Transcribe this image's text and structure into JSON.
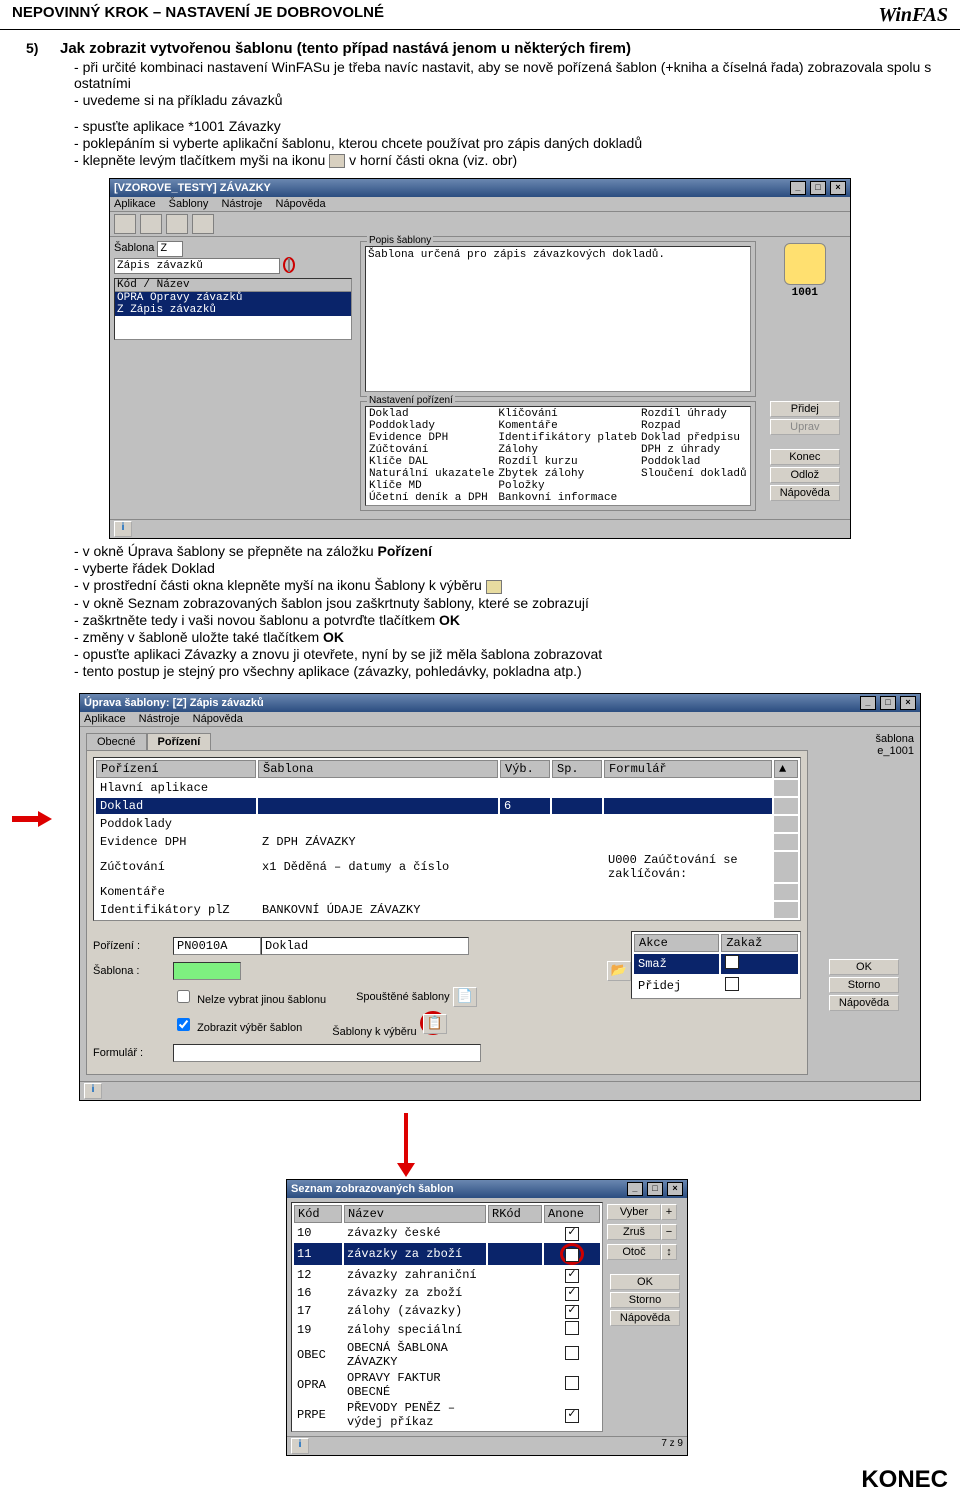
{
  "header": {
    "left": "NEPOVINNÝ KROK – NASTAVENÍ JE DOBROVOLNÉ",
    "brand": "WinFAS"
  },
  "section5": {
    "num": "5)",
    "title": "Jak zobrazit vytvořenou šablonu (tento případ nastává jenom u některých firem)",
    "b1": "při určité kombinaci nastavení WinFASu je třeba navíc nastavit, aby se nově pořízená šablon (+kniha a číselná řada) zobrazovala spolu s ostatními",
    "b2": "uvedeme si na příkladu závazků",
    "b3": "spusťte aplikace *1001 Závazky",
    "b4": "poklepáním si vyberte aplikační šablonu, kterou chcete používat pro zápis daných dokladů",
    "b5a": "klepněte levým tlačítkem myši na ikonu ",
    "b5b": " v horní části okna  (viz. obr)"
  },
  "win1": {
    "title": "[VZOROVE_TESTY] ZÁVAZKY",
    "menu": [
      "Aplikace",
      "Šablony",
      "Nástroje",
      "Nápověda"
    ],
    "sablona_label": "Šablona",
    "sablona_code": "Z",
    "sablona_name": "Zápis závazků",
    "list_header": "Kód / Název",
    "list_rows": [
      "OPRA Opravy závazků",
      "Z    Zápis závazků"
    ],
    "popis_legend": "Popis šablony",
    "popis_text": "Šablona určená pro zápis závazkových dokladů.",
    "nast_legend": "Nastavení pořízení",
    "nast_items": [
      [
        "Doklad",
        "Klíčování",
        "Rozdíl úhrady"
      ],
      [
        "Poddoklady",
        "Komentáře",
        "Rozpad"
      ],
      [
        "Evidence DPH",
        "Identifikátory plateb",
        "Doklad předpisu"
      ],
      [
        "Zúčtování",
        "Zálohy",
        "DPH z úhrady"
      ],
      [
        "Klíče DAL",
        "Rozdíl kurzu",
        "Poddoklad"
      ],
      [
        "Naturální ukazatele",
        "Zbytek zálohy",
        "Sloučení dokladů"
      ],
      [
        "Klíče MD",
        "Položky",
        ""
      ],
      [
        "Účetní deník a DPH",
        "Bankovní informace",
        ""
      ]
    ],
    "app_code": "1001",
    "btns": {
      "pridej": "Přidej",
      "uprav": "Uprav",
      "konec": "Konec",
      "odloz": "Odlož",
      "napoveda": "Nápověda"
    }
  },
  "instr2": {
    "b1a": "v okně Úprava šablony se přepněte na záložku ",
    "b1b": "Pořízení",
    "b2": "vyberte řádek Doklad",
    "b3a": "v prostřední části okna klepněte myší na ikonu Šablony k výběru ",
    "b4": "v okně Seznam zobrazovaných šablon jsou zaškrtnuty šablony, které se zobrazují",
    "b5a": "zaškrtněte tedy i vaši novou šablonu a potvrďte tlačítkem ",
    "b5b": "OK",
    "b6a": "změny v šabloně uložte také tlačítkem ",
    "b6b": "OK",
    "b7": "opusťte aplikaci Závazky a znovu ji otevřete, nyní by se již měla šablona zobrazovat",
    "b8": "tento postup je stejný pro všechny aplikace (závazky, pohledávky, pokladna atp.)"
  },
  "win2": {
    "title": "Úprava šablony: [Z] Zápis závazků",
    "menu": [
      "Aplikace",
      "Nástroje",
      "Nápověda"
    ],
    "tabs": {
      "obecne": "Obecné",
      "porizeni": "Pořízení"
    },
    "sablona_lbl": "šablona",
    "sablona_val": "e_1001",
    "cols": [
      "Pořízení",
      "Šablona",
      "Výb.",
      "Sp.",
      "Formulář"
    ],
    "rows": [
      {
        "c": [
          "Hlavní aplikace",
          "",
          "",
          "",
          ""
        ]
      },
      {
        "c": [
          "Doklad",
          "",
          "6",
          "",
          ""
        ],
        "sel": true
      },
      {
        "c": [
          "Poddoklady",
          "",
          "",
          "",
          ""
        ]
      },
      {
        "c": [
          "Evidence DPH",
          "Z   DPH ZÁVAZKY",
          "",
          "",
          ""
        ]
      },
      {
        "c": [
          "Zúčtování",
          "x1  Děděná – datumy a číslo",
          "",
          "",
          "U000 Zaúčtování se zaklíčován:"
        ]
      },
      {
        "c": [
          "Komentáře",
          "",
          "",
          "",
          ""
        ]
      },
      {
        "c": [
          "Identifikátory plZ",
          "BANKOVNÍ ÚDAJE ZÁVAZKY",
          "",
          "",
          ""
        ]
      }
    ],
    "frm": {
      "porizeni_lbl": "Pořízení :",
      "porizeni_val": "PN0010A",
      "porizeni_txt": "Doklad",
      "sablona_lbl": "Šablona :",
      "chk1": "Nelze vybrat jinou šablonu",
      "spoustene": "Spouštěné šablony",
      "chk2": "Zobrazit výběr šablon",
      "kvyberu": "Šablony k výběru",
      "form_lbl": "Formulář :"
    },
    "akce": {
      "hdr_akce": "Akce",
      "hdr_zakaz": "Zakaž",
      "smaz": "Smaž",
      "pridej": "Přidej"
    },
    "btns": {
      "ok": "OK",
      "storno": "Storno",
      "napoveda": "Nápověda"
    }
  },
  "win3": {
    "title": "Seznam zobrazovaných šablon",
    "cols": [
      "Kód",
      "Název",
      "RKód",
      "Anone"
    ],
    "rows": [
      {
        "k": "10",
        "n": "závazky české",
        "a": true
      },
      {
        "k": "11",
        "n": "závazky za zboží",
        "a": true,
        "sel": true
      },
      {
        "k": "12",
        "n": "závazky zahraniční",
        "a": true
      },
      {
        "k": "16",
        "n": "závazky za zboží",
        "a": true
      },
      {
        "k": "17",
        "n": "zálohy (závazky)",
        "a": true
      },
      {
        "k": "19",
        "n": "zálohy speciální",
        "a": false
      },
      {
        "k": "OBEC",
        "n": "OBECNÁ ŠABLONA ZÁVAZKY",
        "a": false
      },
      {
        "k": "OPRA",
        "n": "OPRAVY FAKTUR OBECNÉ",
        "a": false
      },
      {
        "k": "PRPE",
        "n": "PŘEVODY PENĚZ – výdej příkaz",
        "a": true
      }
    ],
    "btns": {
      "vyber": "Vyber",
      "plus": "+",
      "zrus": "Zruš",
      "minus": "−",
      "otoc": "Otoč",
      "swap": "↕",
      "ok": "OK",
      "storno": "Storno",
      "napoveda": "Nápověda"
    },
    "page": "7 z 9"
  },
  "konec": "KONEC"
}
